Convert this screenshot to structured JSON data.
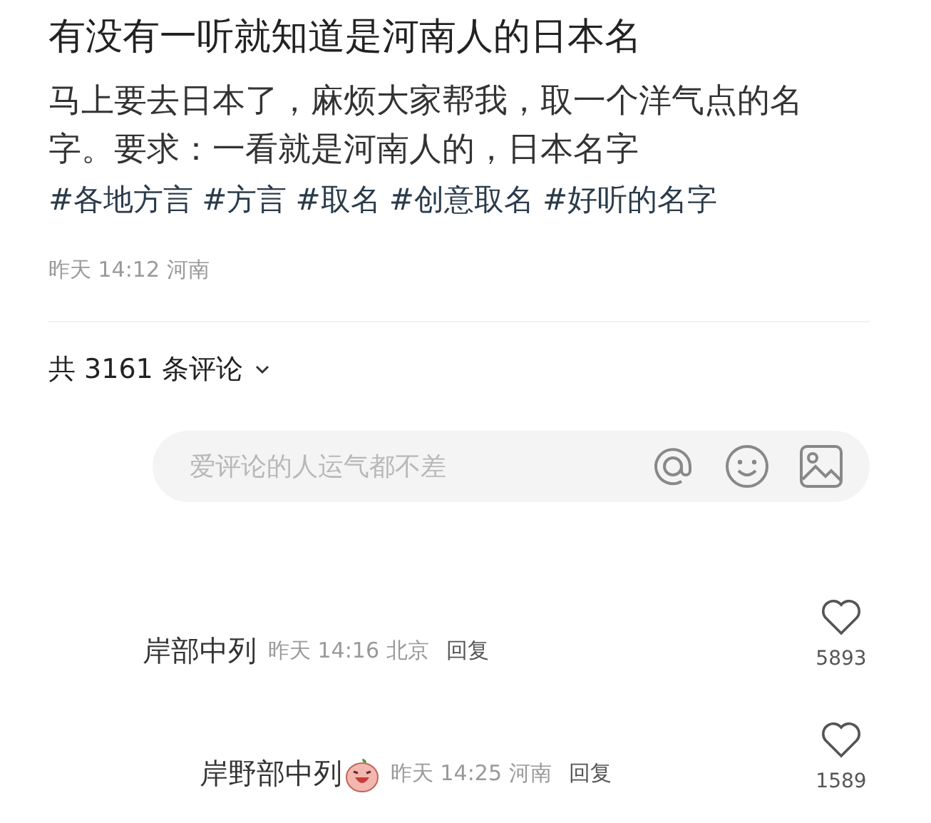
{
  "post": {
    "title": "有没有一听就知道是河南人的日本名",
    "body": "马上要去日本了，麻烦大家帮我，取一个洋气点的名字。要求：一看就是河南人的，日本名字",
    "tags": [
      "#各地方言",
      "#方言",
      "#取名",
      "#创意取名",
      "#好听的名字"
    ],
    "meta": "昨天 14:12 河南"
  },
  "comment_count": "共 3161 条评论",
  "comment_input": {
    "placeholder": "爱评论的人运气都不差"
  },
  "comments": [
    {
      "name": "岸部中列",
      "sticker": false,
      "meta": "昨天 14:16 北京",
      "reply": "回复",
      "likes": "5893",
      "indent": false
    },
    {
      "name": "岸野部中列",
      "sticker": true,
      "meta": "昨天 14:25 河南",
      "reply": "回复",
      "likes": "1589",
      "indent": true
    }
  ]
}
